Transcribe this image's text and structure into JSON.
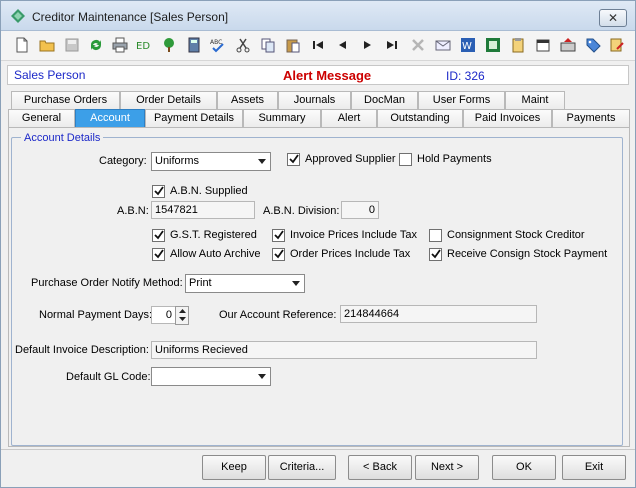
{
  "window": {
    "title": "Creditor Maintenance  [Sales Person]",
    "close_label": "✕"
  },
  "toolbar": {
    "icons": [
      "new-document-icon",
      "open-folder-icon",
      "save-icon",
      "refresh-icon",
      "print-icon",
      "edit-id-icon",
      "tree-icon",
      "calculator-icon",
      "spellcheck-icon",
      "cut-icon",
      "copy-icon",
      "paste-icon",
      "first-record-icon",
      "previous-record-icon",
      "next-record-icon",
      "last-record-icon",
      "delete-icon",
      "email-icon",
      "word-icon",
      "excel-icon",
      "clipboard-icon",
      "calendar-icon",
      "keyboard-icon",
      "tag-icon",
      "edit-note-icon"
    ]
  },
  "info": {
    "left": "Sales Person",
    "alert": "Alert Message",
    "id": "ID: 326"
  },
  "tabs_row1": [
    "Purchase Orders",
    "Order Details",
    "Assets",
    "Journals",
    "DocMan",
    "User Forms",
    "Maint"
  ],
  "tabs_row2": [
    "General",
    "Account",
    "Payment Details",
    "Summary",
    "Alert",
    "Outstanding",
    "Paid Invoices",
    "Payments"
  ],
  "group": {
    "label": "Account Details"
  },
  "form": {
    "category_label": "Category:",
    "category_value": "Uniforms",
    "approved_supplier": "Approved Supplier",
    "hold_payments": "Hold Payments",
    "abn_supplied": "A.B.N. Supplied",
    "abn_label": "A.B.N:",
    "abn_value": "1547821",
    "abn_division_label": "A.B.N. Division:",
    "abn_division_value": "0",
    "gst_registered": "G.S.T. Registered",
    "invoice_prices_tax": "Invoice Prices Include Tax",
    "consignment_creditor": "Consignment Stock Creditor",
    "allow_auto_archive": "Allow Auto Archive",
    "order_prices_tax": "Order Prices Include Tax",
    "receive_consign_payment": "Receive Consign Stock Payment",
    "po_notify_label": "Purchase Order Notify Method:",
    "po_notify_value": "Print",
    "payment_days_label": "Normal Payment Days:",
    "payment_days_value": "0",
    "account_ref_label": "Our Account Reference:",
    "account_ref_value": "214844664",
    "invoice_desc_label": "Default Invoice Description:",
    "invoice_desc_value": "Uniforms Recieved",
    "gl_code_label": "Default GL Code:",
    "gl_code_value": ""
  },
  "checks": {
    "approved_supplier": true,
    "hold_payments": false,
    "abn_supplied": true,
    "gst_registered": true,
    "invoice_prices_tax": true,
    "consignment_creditor": false,
    "allow_auto_archive": true,
    "order_prices_tax": true,
    "receive_consign_payment": true
  },
  "buttons": {
    "keep": "Keep",
    "criteria": "Criteria...",
    "back": "< Back",
    "next": "Next >",
    "ok": "OK",
    "exit": "Exit"
  },
  "colors": {
    "accent": "#3c9fe8",
    "alert": "#cc0000",
    "info_text": "#1c28c8"
  }
}
